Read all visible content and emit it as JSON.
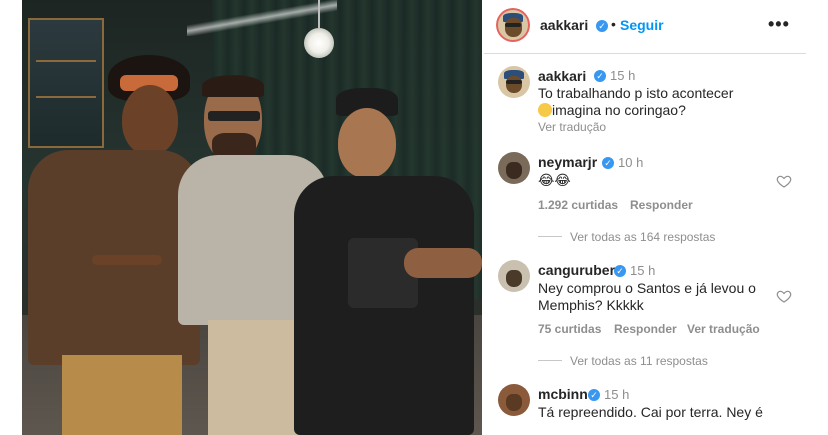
{
  "post": {
    "author": "aakkari",
    "follow_label": "Seguir",
    "more_label": "•••"
  },
  "caption": {
    "author": "aakkari",
    "time": "15 h",
    "line1": "To trabalhando p isto acontecer",
    "line2": "imagina no coringao?",
    "translate_label": "Ver tradução"
  },
  "comments": [
    {
      "author": "neymarjr",
      "time": "10 h",
      "text": "😂😂",
      "likes": "1.292 curtidas",
      "reply_label": "Responder",
      "view_replies": "Ver todas as 164 respostas"
    },
    {
      "author": "canguruber",
      "time": "15 h",
      "line1": "Ney comprou o Santos e já levou o",
      "line2": "Memphis? Kkkkk",
      "likes": "75 curtidas",
      "reply_label": "Responder",
      "translate_label": "Ver tradução",
      "view_replies": "Ver todas as 11 respostas"
    },
    {
      "author": "mcbinn",
      "time": "15 h",
      "line1": "Tá repreendido. Cai por terra. Ney é"
    }
  ],
  "colors": {
    "link_blue": "#0095f6",
    "verified_blue": "#3897f0",
    "muted_gray": "#8e8e8e"
  }
}
